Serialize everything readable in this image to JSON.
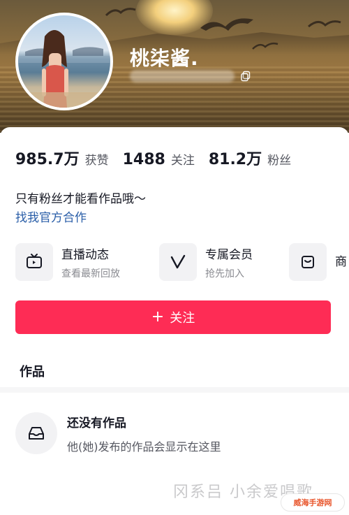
{
  "profile": {
    "nickname": "桃柒酱."
  },
  "stats": [
    {
      "value": "985.7万",
      "label": "获赞"
    },
    {
      "value": "1488",
      "label": "关注"
    },
    {
      "value": "81.2万",
      "label": "粉丝"
    }
  ],
  "bio": {
    "text": "只有粉丝才能看作品哦～",
    "link": "找我官方合作"
  },
  "cards": [
    {
      "title": "直播动态",
      "subtitle": "查看最新回放",
      "icon": "tv-icon"
    },
    {
      "title": "专属会员",
      "subtitle": "抢先加入",
      "icon": "v-icon"
    },
    {
      "title": "商",
      "subtitle": "",
      "icon": "bag-icon"
    }
  ],
  "follow_button": {
    "icon": "plus-icon",
    "label": "关注"
  },
  "tabs": {
    "works": "作品"
  },
  "empty_state": {
    "title": "还没有作品",
    "subtitle": "他(她)发布的作品会显示在这里",
    "icon": "inbox-icon"
  },
  "watermark": {
    "text": "冈系吕 小余爱唱歌",
    "site": "威海手游网"
  },
  "colors": {
    "accent": "#fe2c55",
    "link": "#2a5ea8"
  }
}
